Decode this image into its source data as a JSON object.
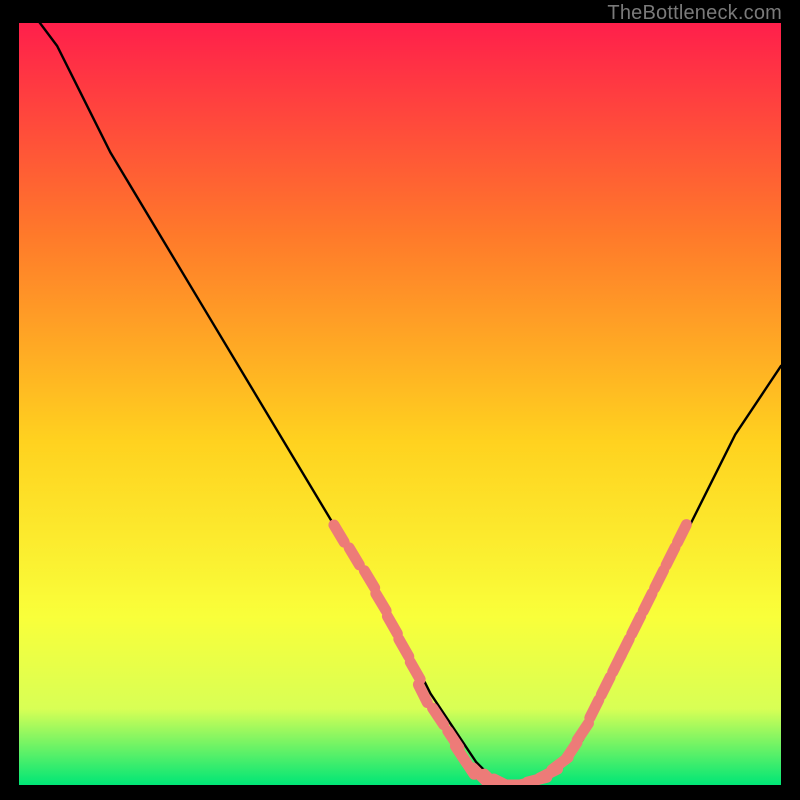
{
  "watermark": "TheBottleneck.com",
  "colors": {
    "frame_background": "#000000",
    "gradient_top": "#ff1f4b",
    "gradient_mid1": "#ff7a2a",
    "gradient_mid2": "#ffd21f",
    "gradient_low1": "#f9ff3a",
    "gradient_low2": "#d8ff55",
    "gradient_bottom": "#00e676",
    "curve_stroke": "#000000",
    "marker_fill": "#ed7b78",
    "marker_stroke": "#ed7b78",
    "watermark_color": "#7a7a7a"
  },
  "chart_data": {
    "type": "line",
    "title": "",
    "xlabel": "",
    "ylabel": "",
    "xlim": [
      0,
      100
    ],
    "ylim": [
      0,
      100
    ],
    "grid": false,
    "legend": false,
    "series": [
      {
        "name": "bottleneck-curve",
        "x": [
          0,
          2,
          5,
          8,
          12,
          18,
          24,
          30,
          36,
          42,
          48,
          52,
          54,
          56,
          58,
          60,
          62,
          64,
          66,
          68,
          70,
          72,
          74,
          76,
          78,
          82,
          86,
          90,
          94,
          98,
          100
        ],
        "y": [
          104,
          101,
          97,
          91,
          83,
          73,
          63,
          53,
          43,
          33,
          23,
          16,
          12,
          9,
          6,
          3,
          1,
          0,
          0,
          0.5,
          1.5,
          3,
          6,
          10,
          14,
          22,
          30,
          38,
          46,
          52,
          55
        ]
      }
    ],
    "markers": [
      {
        "x": 42,
        "y": 33
      },
      {
        "x": 44,
        "y": 30
      },
      {
        "x": 46,
        "y": 27
      },
      {
        "x": 47.5,
        "y": 24
      },
      {
        "x": 49,
        "y": 21
      },
      {
        "x": 50.5,
        "y": 18
      },
      {
        "x": 52,
        "y": 15
      },
      {
        "x": 53,
        "y": 12
      },
      {
        "x": 55,
        "y": 9
      },
      {
        "x": 57,
        "y": 6
      },
      {
        "x": 58,
        "y": 4
      },
      {
        "x": 59,
        "y": 2.5
      },
      {
        "x": 60.5,
        "y": 1.3
      },
      {
        "x": 62,
        "y": 0.5
      },
      {
        "x": 63.5,
        "y": 0.2
      },
      {
        "x": 65,
        "y": 0
      },
      {
        "x": 66.5,
        "y": 0.2
      },
      {
        "x": 68,
        "y": 0.7
      },
      {
        "x": 69.5,
        "y": 1.5
      },
      {
        "x": 71,
        "y": 2.8
      },
      {
        "x": 72.5,
        "y": 4.5
      },
      {
        "x": 74,
        "y": 7
      },
      {
        "x": 75.5,
        "y": 10
      },
      {
        "x": 77,
        "y": 13
      },
      {
        "x": 78.5,
        "y": 16
      },
      {
        "x": 79.5,
        "y": 18
      },
      {
        "x": 81,
        "y": 21
      },
      {
        "x": 82.5,
        "y": 24
      },
      {
        "x": 84,
        "y": 27
      },
      {
        "x": 85.5,
        "y": 30
      },
      {
        "x": 87,
        "y": 33
      }
    ]
  }
}
